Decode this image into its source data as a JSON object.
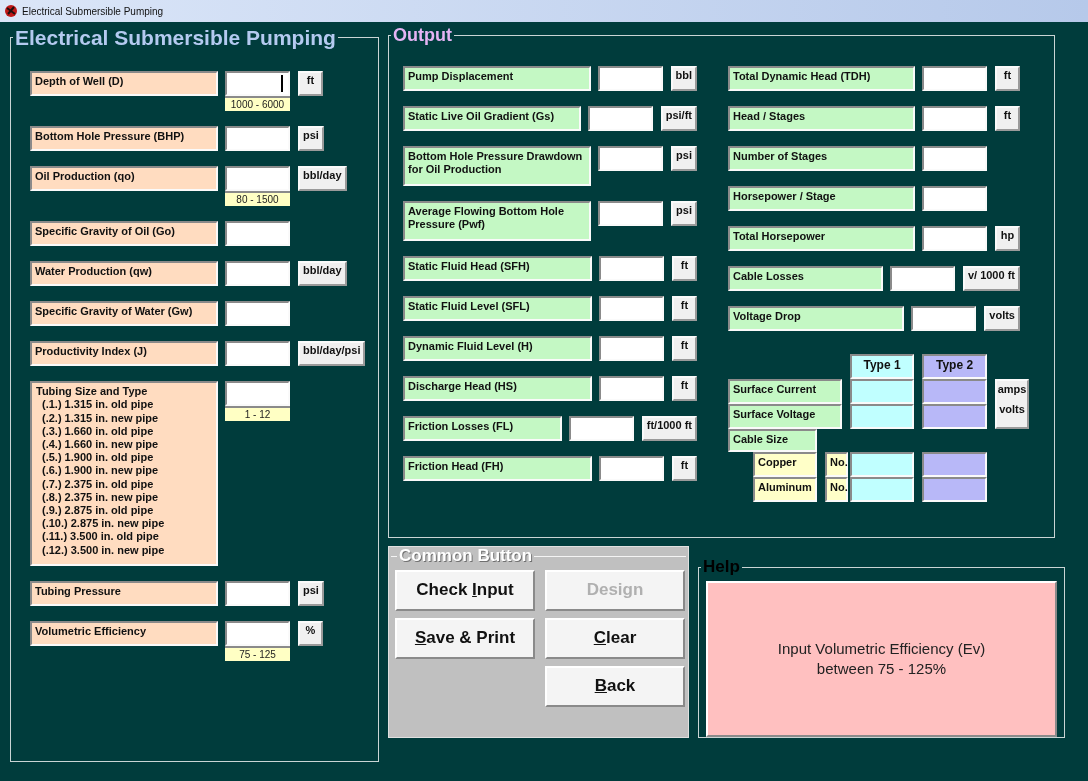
{
  "window": {
    "title": "Electrical Submersible Pumping"
  },
  "input_panel": {
    "title": "Electrical Submersible Pumping",
    "fields": [
      {
        "kind": "single",
        "label": "Depth of Well (D)",
        "unit": "ft",
        "hint": "1000 - 6000",
        "focused": true
      },
      {
        "kind": "single",
        "label": "Bottom Hole Pressure (BHP)",
        "unit": "psi",
        "focused": false
      },
      {
        "kind": "single",
        "label": "Oil Production (qo)",
        "unit": "bbl/day",
        "hint": "80 - 1500",
        "focused": false
      },
      {
        "kind": "single",
        "label": "Specific Gravity of Oil (Go)",
        "focused": false
      },
      {
        "kind": "single",
        "label": "Water Production (qw)",
        "unit": "bbl/day",
        "focused": false
      },
      {
        "kind": "single",
        "label": "Specific Gravity of Water (Gw)",
        "focused": false
      },
      {
        "kind": "single",
        "label": "Productivity Index (J)",
        "unit": "bbl/day/psi",
        "focused": false
      },
      {
        "kind": "list",
        "label": "Tubing Size and Type",
        "hint": "1 - 12",
        "focused": false,
        "options": [
          "(.1.) 1.315 in. old pipe",
          "(.2.) 1.315 in. new pipe",
          "(.3.) 1.660 in. old pipe",
          "(.4.) 1.660 in. new pipe",
          "(.5.) 1.900 in. old pipe",
          "(.6.) 1.900 in. new pipe",
          "(.7.) 2.375 in. old pipe",
          "(.8.) 2.375 in. new pipe",
          "(.9.) 2.875 in. old pipe",
          "(.10.) 2.875 in. new pipe",
          "(.11.) 3.500 in. old pipe",
          "(.12.) 3.500 in. new pipe"
        ]
      },
      {
        "kind": "single",
        "label": "Tubing Pressure",
        "unit": "psi",
        "focused": false
      },
      {
        "kind": "single",
        "label": "Volumetric Efficiency",
        "unit": "%",
        "hint": "75 - 125",
        "focused": false
      }
    ]
  },
  "output": {
    "title": "Output",
    "left_fields": [
      {
        "label": "Pump Displacement",
        "unit": "bbl"
      },
      {
        "label": "Static Live Oil Gradient (Gs)",
        "unit": "psi/ft"
      },
      {
        "label": "Bottom Hole Pressure Drawdown for Oil Production",
        "unit": "psi"
      },
      {
        "label": "Average Flowing Bottom Hole Pressure (Pwf)",
        "unit": "psi"
      },
      {
        "label": "Static Fluid Head (SFH)",
        "unit": "ft"
      },
      {
        "label": "Static Fluid Level (SFL)",
        "unit": "ft"
      },
      {
        "label": "Dynamic Fluid Level (H)",
        "unit": "ft"
      },
      {
        "label": "Discharge Head (HS)",
        "unit": "ft"
      },
      {
        "label": "Friction Losses (FL)",
        "unit": "ft/1000 ft"
      },
      {
        "label": "Friction Head (FH)",
        "unit": "ft"
      }
    ],
    "right_fields": [
      {
        "label": "Total Dynamic Head (TDH)",
        "unit": "ft"
      },
      {
        "label": "Head / Stages",
        "unit": "ft"
      },
      {
        "label": "Number of Stages"
      },
      {
        "label": "Horsepower / Stage"
      },
      {
        "label": "Total Horsepower",
        "unit": "hp"
      },
      {
        "label": "Cable Losses",
        "unit": "v/ 1000 ft"
      },
      {
        "label": "Voltage Drop",
        "unit": "volts"
      }
    ],
    "cable": {
      "columns": [
        "Type 1",
        "Type 2"
      ],
      "rows": [
        {
          "label": "Surface Current",
          "unit": "amps"
        },
        {
          "label": "Surface Voltage",
          "unit": "volts"
        }
      ],
      "size_label": "Cable Size",
      "materials": [
        {
          "label": "Copper",
          "prefix": "No."
        },
        {
          "label": "Aluminum",
          "prefix": "No."
        }
      ]
    }
  },
  "common_buttons": {
    "title": "Common Button",
    "columns": [
      [
        {
          "disabled": false,
          "label": [
            {
              "text": "Check ",
              "underline": false
            },
            {
              "text": "I",
              "underline": true
            },
            {
              "text": "nput",
              "underline": false
            }
          ]
        },
        {
          "disabled": false,
          "label": [
            {
              "text": "S",
              "underline": true
            },
            {
              "text": "ave & Print",
              "underline": false
            }
          ]
        }
      ],
      [
        {
          "disabled": true,
          "label": [
            {
              "text": "Design",
              "underline": false
            }
          ]
        },
        {
          "disabled": false,
          "label": [
            {
              "text": "C",
              "underline": true
            },
            {
              "text": "lear",
              "underline": false
            }
          ]
        },
        {
          "disabled": false,
          "label": [
            {
              "text": "B",
              "underline": true
            },
            {
              "text": "ack",
              "underline": false
            }
          ]
        }
      ]
    ]
  },
  "help": {
    "title": "Help",
    "lines": [
      "Input Volumetric Efficiency (Ev)",
      "between 75 - 125%"
    ]
  }
}
